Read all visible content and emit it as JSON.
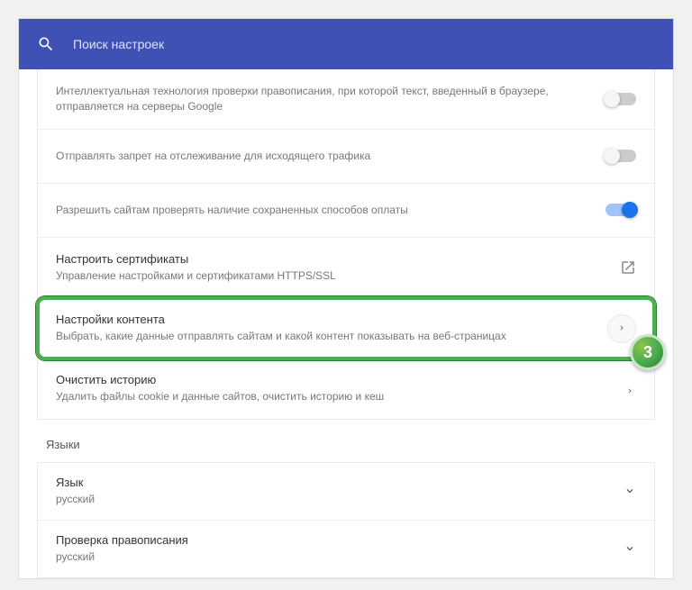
{
  "search": {
    "placeholder": "Поиск настроек"
  },
  "rows": {
    "spellcheck": "Интеллектуальная технология проверки правописания, при которой текст, введенный в браузере, отправляется на серверы Google",
    "dnt": "Отправлять запрет на отслеживание для исходящего трафика",
    "payment": "Разрешить сайтам проверять наличие сохраненных способов оплаты",
    "certs_title": "Настроить сертификаты",
    "certs_desc": "Управление настройками и сертификатами HTTPS/SSL",
    "content_title": "Настройки контента",
    "content_desc": "Выбрать, какие данные отправлять сайтам и какой контент показывать на веб-страницах",
    "clear_title": "Очистить историю",
    "clear_desc": "Удалить файлы cookie и данные сайтов, очистить историю и кеш"
  },
  "languages": {
    "section": "Языки",
    "lang_title": "Язык",
    "lang_value": "русский",
    "spell_title": "Проверка правописания",
    "spell_value": "русский"
  },
  "badge": "3"
}
